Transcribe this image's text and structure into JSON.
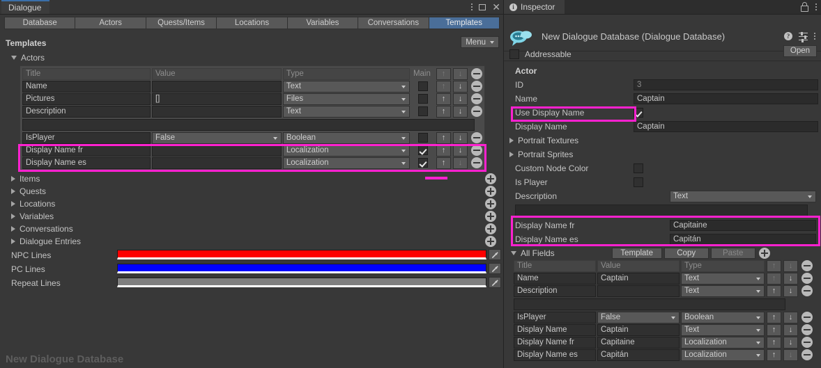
{
  "window": {
    "tab_label": "Dialogue",
    "controls": [
      "more-menu",
      "maximize",
      "close"
    ]
  },
  "toolbar_tabs": [
    {
      "label": "Database",
      "active": false
    },
    {
      "label": "Actors",
      "active": false
    },
    {
      "label": "Quests/Items",
      "active": false
    },
    {
      "label": "Locations",
      "active": false
    },
    {
      "label": "Variables",
      "active": false
    },
    {
      "label": "Conversations",
      "active": false
    },
    {
      "label": "Templates",
      "active": true
    }
  ],
  "templates": {
    "section_title": "Templates",
    "menu_label": "Menu",
    "actors_foldout": "Actors",
    "table": {
      "headers": {
        "title": "Title",
        "value": "Value",
        "type": "Type",
        "main": "Main"
      },
      "rows": [
        {
          "title": "Name",
          "value": "",
          "type": "Text",
          "main": false,
          "up": true,
          "down": true
        },
        {
          "title": "Pictures",
          "value": "[]",
          "type": "Files",
          "main": false,
          "up": true,
          "down": true
        },
        {
          "title": "Description",
          "value": "",
          "type": "Text",
          "main": false,
          "up": true,
          "down": true
        }
      ],
      "rows2": [
        {
          "title": "IsPlayer",
          "value": "False",
          "type": "Boolean",
          "main": false,
          "up": true,
          "down": true,
          "value_is_popup": true
        },
        {
          "title": "Display Name fr",
          "value": "",
          "type": "Localization",
          "main": true,
          "up": true,
          "down": true,
          "highlighted": true
        },
        {
          "title": "Display Name es",
          "value": "",
          "type": "Localization",
          "main": true,
          "up": true,
          "down": false,
          "highlighted": true
        }
      ]
    },
    "foldouts": [
      "Items",
      "Quests",
      "Locations",
      "Variables",
      "Conversations",
      "Dialogue Entries"
    ],
    "color_rows": [
      {
        "label": "NPC Lines",
        "color": "#fe0000"
      },
      {
        "label": "PC Lines",
        "color": "#0000ff"
      },
      {
        "label": "Repeat Lines",
        "color": "#7f7f7f"
      }
    ],
    "database_label": "New Dialogue Database"
  },
  "inspector": {
    "tab_label": "Inspector",
    "object_title": "New Dialogue Database (Dialogue Database)",
    "open_button": "Open",
    "addressable_label": "Addressable",
    "addressable_checked": false,
    "actor_header": "Actor",
    "fields": [
      {
        "label": "ID",
        "value": "3",
        "readonly": true,
        "kind": "field"
      },
      {
        "label": "Name",
        "value": "Captain",
        "kind": "field"
      },
      {
        "label": "Use Display Name",
        "value": true,
        "kind": "checkbox",
        "highlighted": true
      },
      {
        "label": "Display Name",
        "value": "Captain",
        "kind": "field"
      },
      {
        "label": "Portrait Textures",
        "kind": "foldout"
      },
      {
        "label": "Portrait Sprites",
        "kind": "foldout"
      },
      {
        "label": "Custom Node Color",
        "value": false,
        "kind": "checkbox"
      },
      {
        "label": "Is Player",
        "value": false,
        "kind": "checkbox"
      },
      {
        "label": "Description",
        "value": "Text",
        "kind": "popup"
      }
    ],
    "localized": [
      {
        "label": "Display Name fr",
        "value": "Capitaine"
      },
      {
        "label": "Display Name es",
        "value": "Capitán"
      }
    ],
    "all_fields": {
      "title": "All Fields",
      "buttons": [
        {
          "label": "Template",
          "enabled": true
        },
        {
          "label": "Copy",
          "enabled": true
        },
        {
          "label": "Paste",
          "enabled": false
        }
      ],
      "headers": {
        "title": "Title",
        "value": "Value",
        "type": "Type"
      },
      "rows_top": [
        {
          "title": "Name",
          "value": "Captain",
          "type": "Text",
          "up": false,
          "down": true
        },
        {
          "title": "Description",
          "value": "",
          "type": "Text",
          "up": true,
          "down": true
        }
      ],
      "rows_bottom": [
        {
          "title": "IsPlayer",
          "value": "False",
          "type": "Boolean",
          "up": true,
          "down": true,
          "value_is_popup": true
        },
        {
          "title": "Display Name",
          "value": "Captain",
          "type": "Text",
          "up": true,
          "down": true
        },
        {
          "title": "Display Name fr",
          "value": "Capitaine",
          "type": "Localization",
          "up": true,
          "down": true
        },
        {
          "title": "Display Name es",
          "value": "Capitán",
          "type": "Localization",
          "up": true,
          "down": false
        }
      ]
    }
  },
  "colors": {
    "highlight": "#ff21d0",
    "accent_tab": "#4a6e99",
    "panel": "#383838"
  }
}
